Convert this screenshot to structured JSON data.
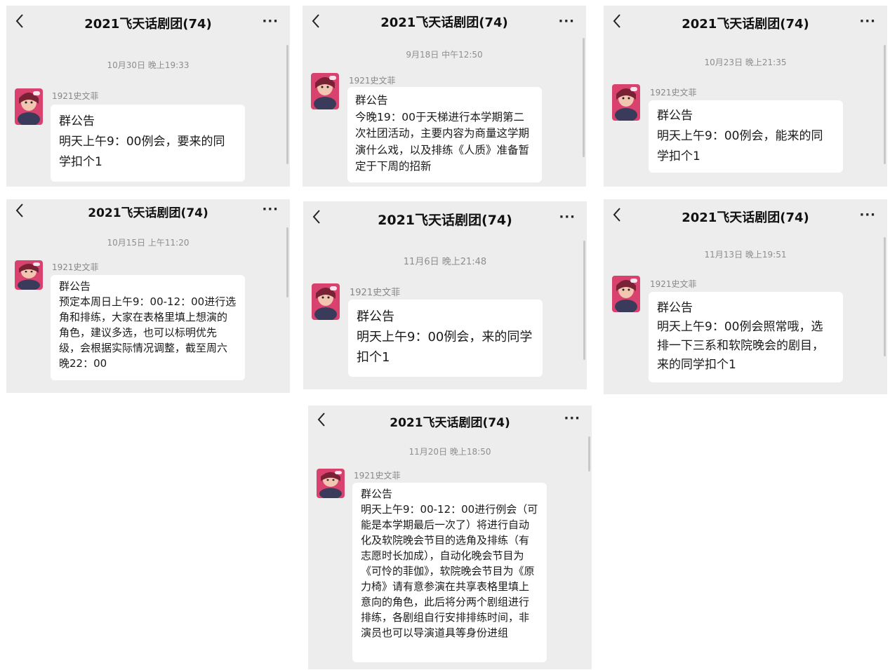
{
  "group_title": "2021飞天话剧团(74)",
  "sender": "1921史文菲",
  "more_label": "···",
  "colors": {
    "panel_bg": "#ededed",
    "bubble_bg": "#ffffff",
    "avatar_bg": "#d9426f"
  },
  "screens": [
    {
      "time": "10月30日 晚上19:33",
      "heading": "群公告",
      "body": "明天上午9：00例会，要来的同学扣个1"
    },
    {
      "time": "9月18日 中午12:50",
      "heading": "群公告",
      "body": "今晚19：00于天梯进行本学期第二次社团活动，主要内容为商量这学期演什么戏，以及排练《人质》准备暂定于下周的招新"
    },
    {
      "time": "10月23日 晚上21:35",
      "heading": "群公告",
      "body": "明天上午9：00例会，能来的同学扣个1"
    },
    {
      "time": "10月15日 上午11:20",
      "heading": "群公告",
      "body": "预定本周日上午9：00-12：00进行选角和排练，大家在表格里填上想演的角色，建议多选，也可以标明优先级，会根据实际情况调整，截至周六晚22：00"
    },
    {
      "time": "11月6日 晚上21:48",
      "heading": "群公告",
      "body": "明天上午9：00例会，来的同学扣个1"
    },
    {
      "time": "11月13日 晚上19:51",
      "heading": "群公告",
      "body": "明天上午9：00例会照常哦，选排一下三系和软院晚会的剧目，来的同学扣个1"
    },
    {
      "time": "11月20日 晚上18:50",
      "heading": "群公告",
      "body": "明天上午9：00-12：00进行例会（可能是本学期最后一次了）将进行自动化及软院晚会节目的选角及排练（有志愿时长加成），自动化晚会节目为《可怜的菲伽》，软院晚会节目为《原力椅》请有意参演在共享表格里填上意向的角色，此后将分两个剧组进行排练，各剧组自行安排排练时间，非演员也可以导演道具等身份进组"
    }
  ]
}
